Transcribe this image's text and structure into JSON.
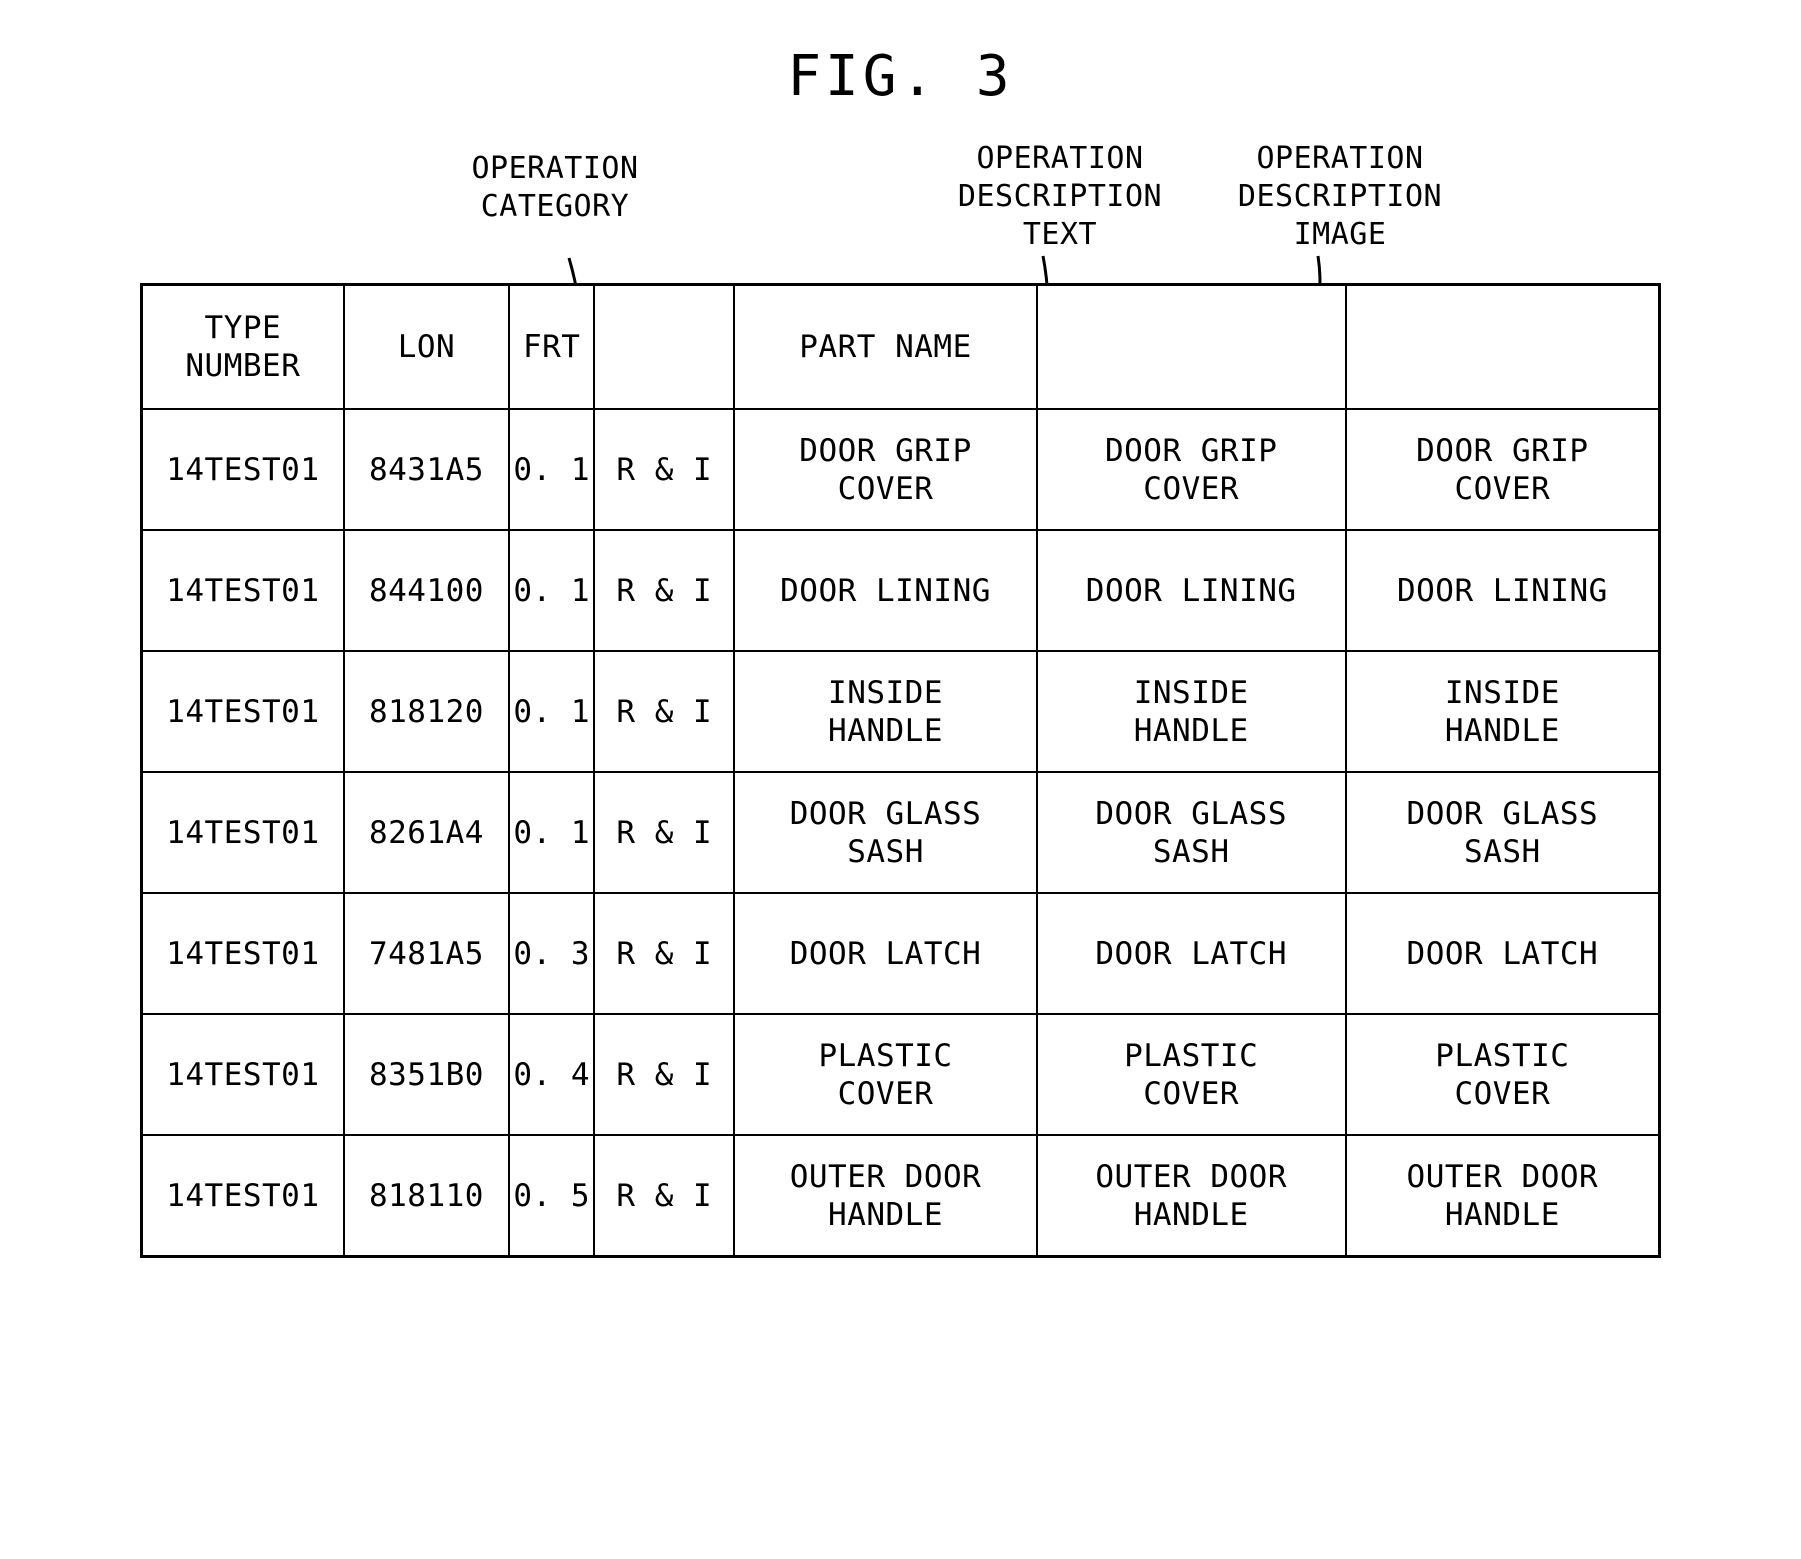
{
  "figure": {
    "title": "FIG. 3"
  },
  "callouts": [
    {
      "id": "operation-category",
      "text": "OPERATION\nCATEGORY"
    },
    {
      "id": "operation-description-text",
      "text": "OPERATION\nDESCRIPTION\nTEXT"
    },
    {
      "id": "operation-description-image",
      "text": "OPERATION\nDESCRIPTION\nIMAGE"
    }
  ],
  "table": {
    "headers": [
      "TYPE\nNUMBER",
      "LON",
      "FRT",
      "",
      "PART NAME",
      "",
      ""
    ],
    "rows": [
      {
        "type_number": "14TEST01",
        "lon": "8431A5",
        "frt": "0. 1",
        "operation_category": "R & I",
        "part_name": "DOOR GRIP\nCOVER",
        "operation_description_text": "DOOR GRIP\nCOVER",
        "operation_description_image": "DOOR GRIP\nCOVER"
      },
      {
        "type_number": "14TEST01",
        "lon": "844100",
        "frt": "0. 1",
        "operation_category": "R & I",
        "part_name": "DOOR LINING",
        "operation_description_text": "DOOR LINING",
        "operation_description_image": "DOOR LINING"
      },
      {
        "type_number": "14TEST01",
        "lon": "818120",
        "frt": "0. 1",
        "operation_category": "R & I",
        "part_name": "INSIDE\nHANDLE",
        "operation_description_text": "INSIDE\nHANDLE",
        "operation_description_image": "INSIDE\nHANDLE"
      },
      {
        "type_number": "14TEST01",
        "lon": "8261A4",
        "frt": "0. 1",
        "operation_category": "R & I",
        "part_name": "DOOR GLASS\nSASH",
        "operation_description_text": "DOOR GLASS\nSASH",
        "operation_description_image": "DOOR GLASS\nSASH"
      },
      {
        "type_number": "14TEST01",
        "lon": "7481A5",
        "frt": "0. 3",
        "operation_category": "R & I",
        "part_name": "DOOR LATCH",
        "operation_description_text": "DOOR LATCH",
        "operation_description_image": "DOOR LATCH"
      },
      {
        "type_number": "14TEST01",
        "lon": "8351B0",
        "frt": "0. 4",
        "operation_category": "R & I",
        "part_name": "PLASTIC\nCOVER",
        "operation_description_text": "PLASTIC\nCOVER",
        "operation_description_image": "PLASTIC\nCOVER"
      },
      {
        "type_number": "14TEST01",
        "lon": "818110",
        "frt": "0. 5",
        "operation_category": "R & I",
        "part_name": "OUTER DOOR\nHANDLE",
        "operation_description_text": "OUTER DOOR\nHANDLE",
        "operation_description_image": "OUTER DOOR\nHANDLE"
      }
    ]
  }
}
